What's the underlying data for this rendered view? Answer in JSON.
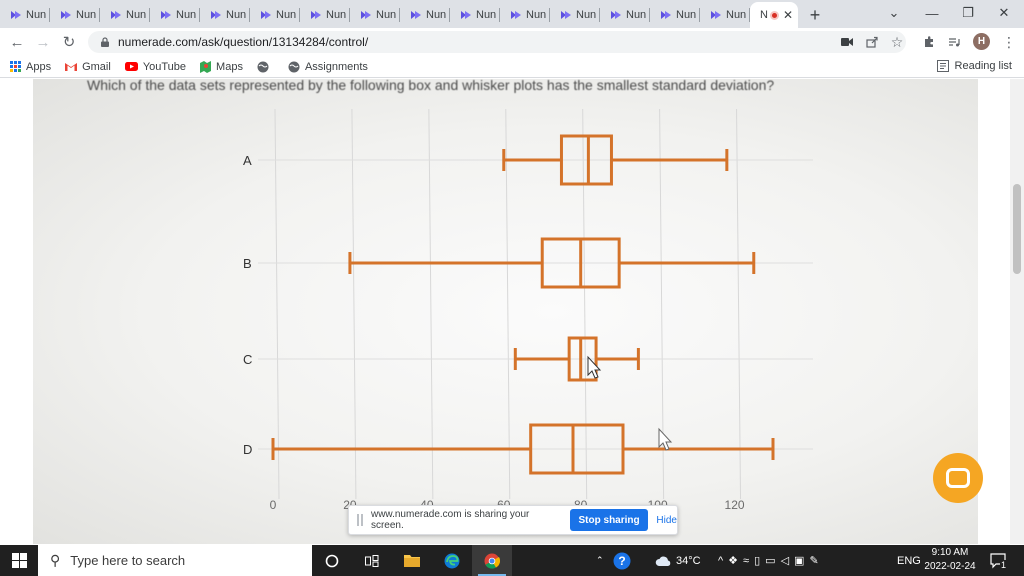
{
  "browser": {
    "tabs": [
      {
        "label": "Nun"
      },
      {
        "label": "Nun"
      },
      {
        "label": "Nun"
      },
      {
        "label": "Nun"
      },
      {
        "label": "Nun"
      },
      {
        "label": "Nun"
      },
      {
        "label": "Nun"
      },
      {
        "label": "Nun"
      },
      {
        "label": "Nun"
      },
      {
        "label": "Nun"
      },
      {
        "label": "Nun"
      },
      {
        "label": "Nun"
      },
      {
        "label": "Nun"
      },
      {
        "label": "Nun"
      },
      {
        "label": "Nun"
      }
    ],
    "active_tab": {
      "label": "N"
    },
    "new_tab": "+",
    "window_controls": {
      "dropdown": "⌄",
      "minimize": "—",
      "restore": "❐",
      "close": "✕"
    },
    "nav": {
      "back": "←",
      "forward": "→",
      "reload": "↻"
    },
    "url": "numerade.com/ask/question/13134284/control/",
    "profile_initial": "H",
    "bookmarks": [
      {
        "label": "Apps",
        "icon": "apps-grid-icon"
      },
      {
        "label": "Gmail",
        "icon": "gmail-icon"
      },
      {
        "label": "YouTube",
        "icon": "youtube-icon"
      },
      {
        "label": "Maps",
        "icon": "maps-icon"
      },
      {
        "label": "",
        "icon": "globe-icon"
      },
      {
        "label": "Assignments",
        "icon": "globe-icon"
      }
    ],
    "reading_list": "Reading list",
    "accent": "#1a73e8",
    "tab_strip_color": "#dee1e6"
  },
  "content": {
    "question_text": "Which of the data sets represented by the following box and whisker plots has the smallest standard deviation?",
    "chart_data": {
      "type": "box",
      "categories": [
        "A",
        "B",
        "C",
        "D"
      ],
      "series": [
        {
          "name": "A",
          "min": 60,
          "q1": 75,
          "median": 82,
          "q3": 88,
          "max": 118
        },
        {
          "name": "B",
          "min": 20,
          "q1": 70,
          "median": 80,
          "q3": 90,
          "max": 125
        },
        {
          "name": "C",
          "min": 63,
          "q1": 77,
          "median": 80,
          "q3": 84,
          "max": 95
        },
        {
          "name": "D",
          "min": 0,
          "q1": 67,
          "median": 78,
          "q3": 91,
          "max": 130
        }
      ],
      "x_ticks": [
        "0",
        "20",
        "40",
        "60",
        "80",
        "100",
        "120"
      ],
      "xlim": [
        0,
        130
      ],
      "grid": true,
      "box_color": "#d4732a"
    },
    "chat_widget_color": "#f5a623"
  },
  "sharing_bar": {
    "message": "www.numerade.com is sharing your screen.",
    "stop_label": "Stop sharing",
    "hide_label": "Hide"
  },
  "taskbar": {
    "search_placeholder": "Type here to search",
    "temperature": "34°C",
    "language": "ENG",
    "time": "9:10 AM",
    "date": "2022-02-24",
    "notification_count": "1"
  }
}
